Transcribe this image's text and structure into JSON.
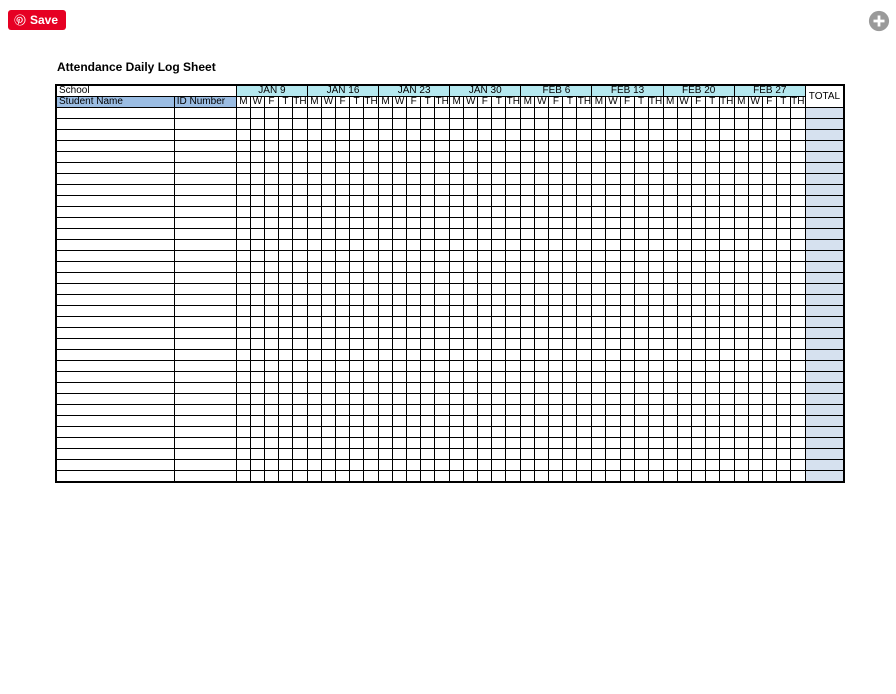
{
  "buttons": {
    "save_label": "Save"
  },
  "sheet": {
    "title": "Attendance Daily Log Sheet",
    "school_label": "School",
    "student_name_header": "Student Name",
    "id_number_header": "ID Number",
    "total_header": "TOTAL",
    "weeks": [
      "JAN 9",
      "JAN 16",
      "JAN 23",
      "JAN 30",
      "FEB 6",
      "FEB 13",
      "FEB 20",
      "FEB 27"
    ],
    "days": [
      "M",
      "W",
      "F",
      "T",
      "TH"
    ],
    "data_row_count": 34
  },
  "colors": {
    "save_bg": "#e60023",
    "week_header_bg": "#b5e8ef",
    "name_header_bg": "#9bbde3",
    "total_col_bg": "#d6e1ef"
  }
}
